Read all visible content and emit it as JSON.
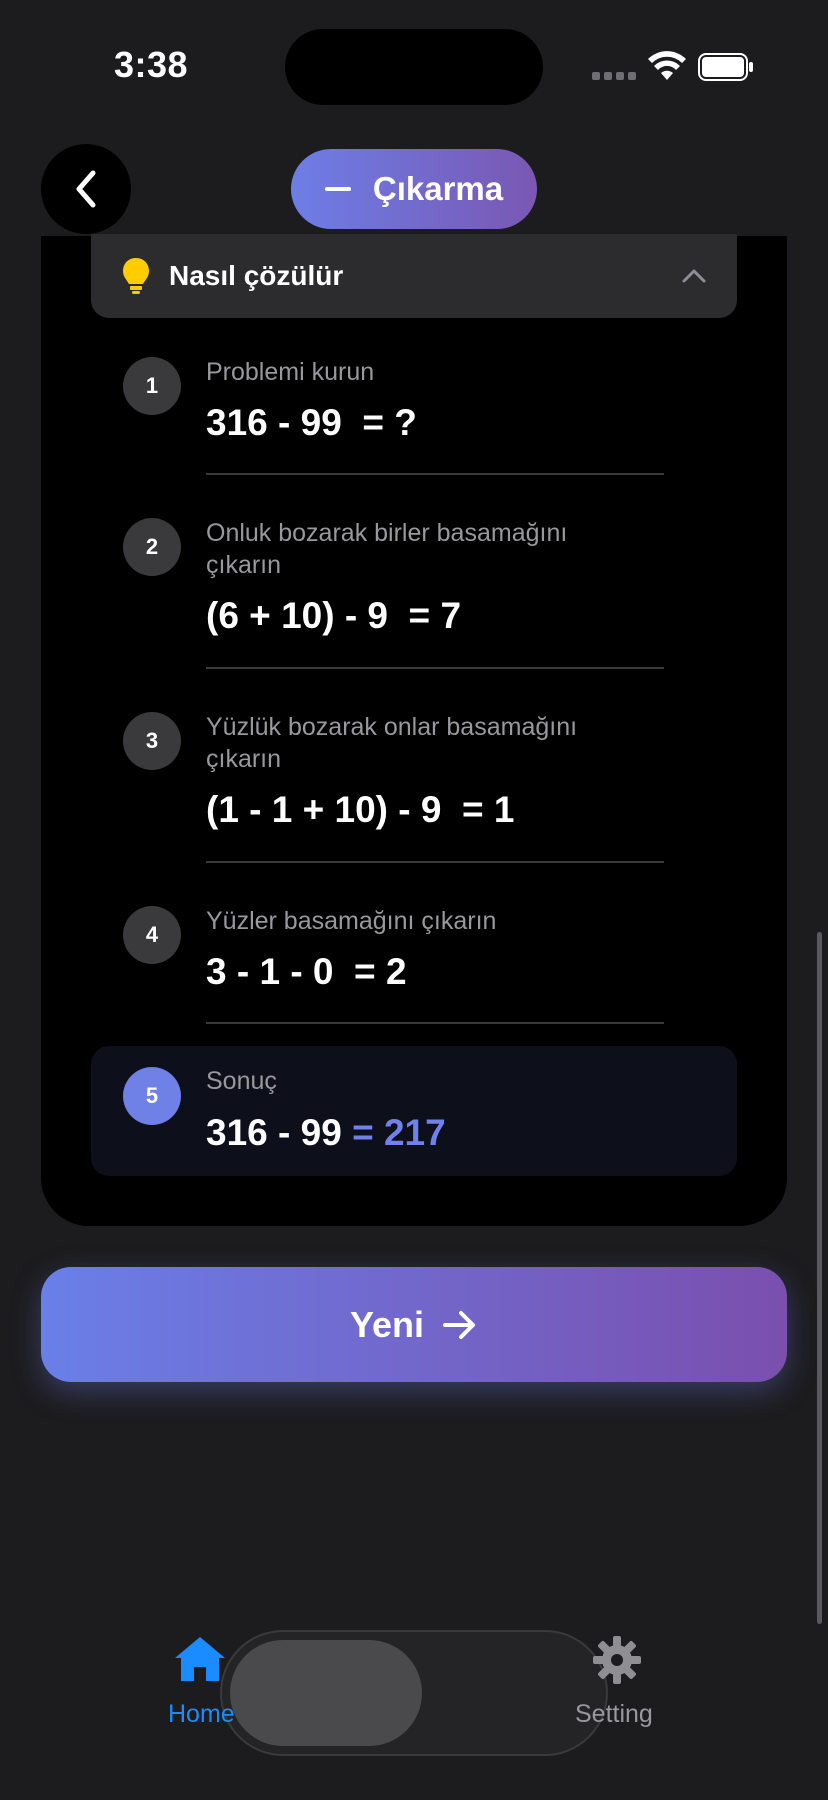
{
  "status_bar": {
    "time": "3:38"
  },
  "nav": {
    "operation_label": "Çıkarma"
  },
  "howto": {
    "title": "Nasıl çözülür"
  },
  "steps": [
    {
      "number": "1",
      "label": "Problemi kurun",
      "expression": "316 - 99  = ?"
    },
    {
      "number": "2",
      "label": "Onluk bozarak birler basamağını çıkarın",
      "expression": "(6 + 10) - 9  = 7"
    },
    {
      "number": "3",
      "label": "Yüzlük bozarak onlar basamağını çıkarın",
      "expression": "(1 - 1 + 10) - 9  = 1"
    },
    {
      "number": "4",
      "label": "Yüzler basamağını çıkarın",
      "expression": "3 - 1 - 0  = 2"
    }
  ],
  "result": {
    "number": "5",
    "label": "Sonuç",
    "expression": "316 - 99 ",
    "answer": "= 217"
  },
  "new_button": {
    "label": "Yeni"
  },
  "tabs": [
    {
      "label": "Home",
      "icon": "house-icon",
      "active": true
    },
    {
      "label": "Setting",
      "icon": "gear-icon",
      "active": false
    }
  ],
  "colors": {
    "accent": "#6f80e6",
    "gradient_start": "#6a7fe8",
    "gradient_end": "#7a4fae",
    "tab_active": "#1a8cff",
    "background": "#1c1c1e"
  }
}
